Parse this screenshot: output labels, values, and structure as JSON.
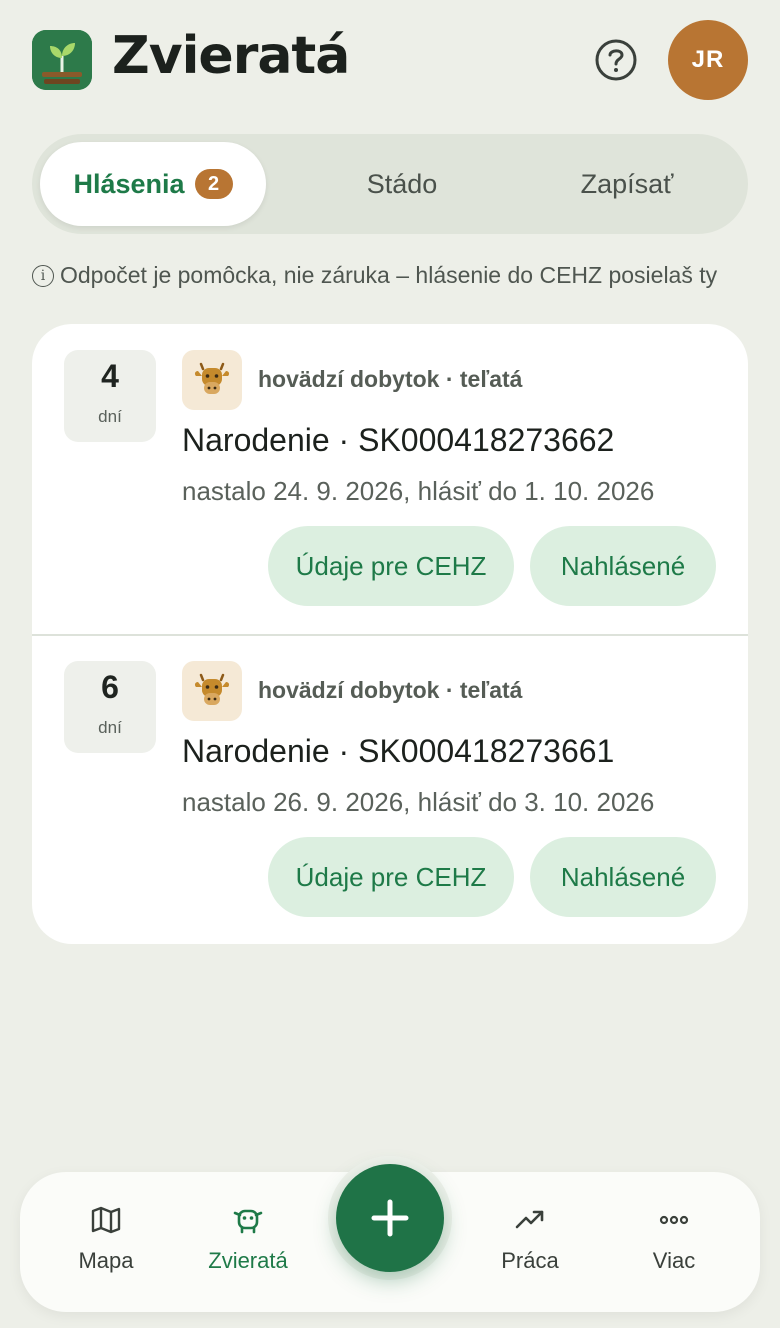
{
  "header": {
    "title": "Zvieratá",
    "avatar_initials": "JR",
    "help_icon": "help-circle-icon",
    "app_icon": "sprout-icon"
  },
  "tabs": [
    {
      "label": "Hlásenia",
      "badge": "2",
      "active": true
    },
    {
      "label": "Stádo",
      "active": false
    },
    {
      "label": "Zapísať",
      "active": false
    }
  ],
  "notice": {
    "icon": "info-icon",
    "text": "Odpočet je pomôcka, nie záruka – hlásenie do CEHZ posielaš ty"
  },
  "reports": [
    {
      "days": "4",
      "days_unit": "dní",
      "category": "hovädzí dobytok · teľatá",
      "title": "Narodenie · SK000418273662",
      "dates": "nastalo 24. 9. 2026, hlásiť do 1. 10. 2026",
      "cehz_button": "Údaje pre CEHZ",
      "done_button": "Nahlásené"
    },
    {
      "days": "6",
      "days_unit": "dní",
      "category": "hovädzí dobytok · teľatá",
      "title": "Narodenie · SK000418273661",
      "dates": "nastalo 26. 9. 2026, hlásiť do 3. 10. 2026",
      "cehz_button": "Údaje pre CEHZ",
      "done_button": "Nahlásené"
    }
  ],
  "nav": {
    "items": [
      {
        "label": "Mapa",
        "icon": "map-icon",
        "active": false
      },
      {
        "label": "Zvieratá",
        "icon": "cow-icon",
        "active": true
      },
      {
        "label": "Práca",
        "icon": "trending-up-icon",
        "active": false
      },
      {
        "label": "Viac",
        "icon": "more-horizontal-icon",
        "active": false
      }
    ],
    "fab_icon": "plus-icon"
  },
  "colors": {
    "background": "#edefe8",
    "primary_green": "#1e7a48",
    "accent_brown": "#b87533",
    "pill_bg": "#dcefe0"
  }
}
